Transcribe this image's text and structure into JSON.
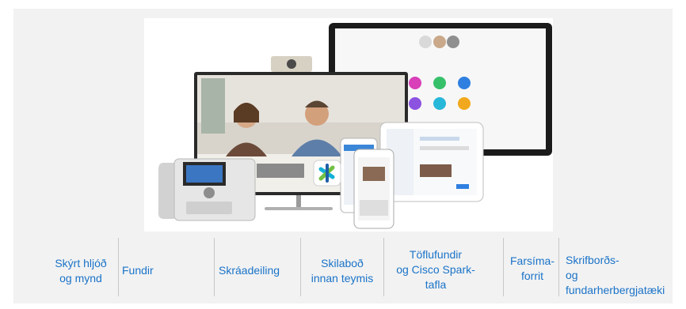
{
  "features": [
    {
      "id": "video",
      "label": "Skýrt hljóð\nog mynd"
    },
    {
      "id": "meetings",
      "label": "Fundir"
    },
    {
      "id": "file-sharing",
      "label": "Skráadeiling"
    },
    {
      "id": "team-messaging",
      "label": "Skilaboð\ninnan teymis"
    },
    {
      "id": "whiteboarding",
      "label": "Töflufundir\nog Cisco Spark-\ntafla"
    },
    {
      "id": "mobile-apps",
      "label": "Farsíma-\nforrit"
    },
    {
      "id": "desk-room-devices",
      "label": "Skrifborðs-\nog\nfundarherbergjatæki"
    }
  ],
  "colors": {
    "panel_background": "#f2f2f2",
    "feature_text": "#1a73c8",
    "divider": "#c8c8c8"
  }
}
